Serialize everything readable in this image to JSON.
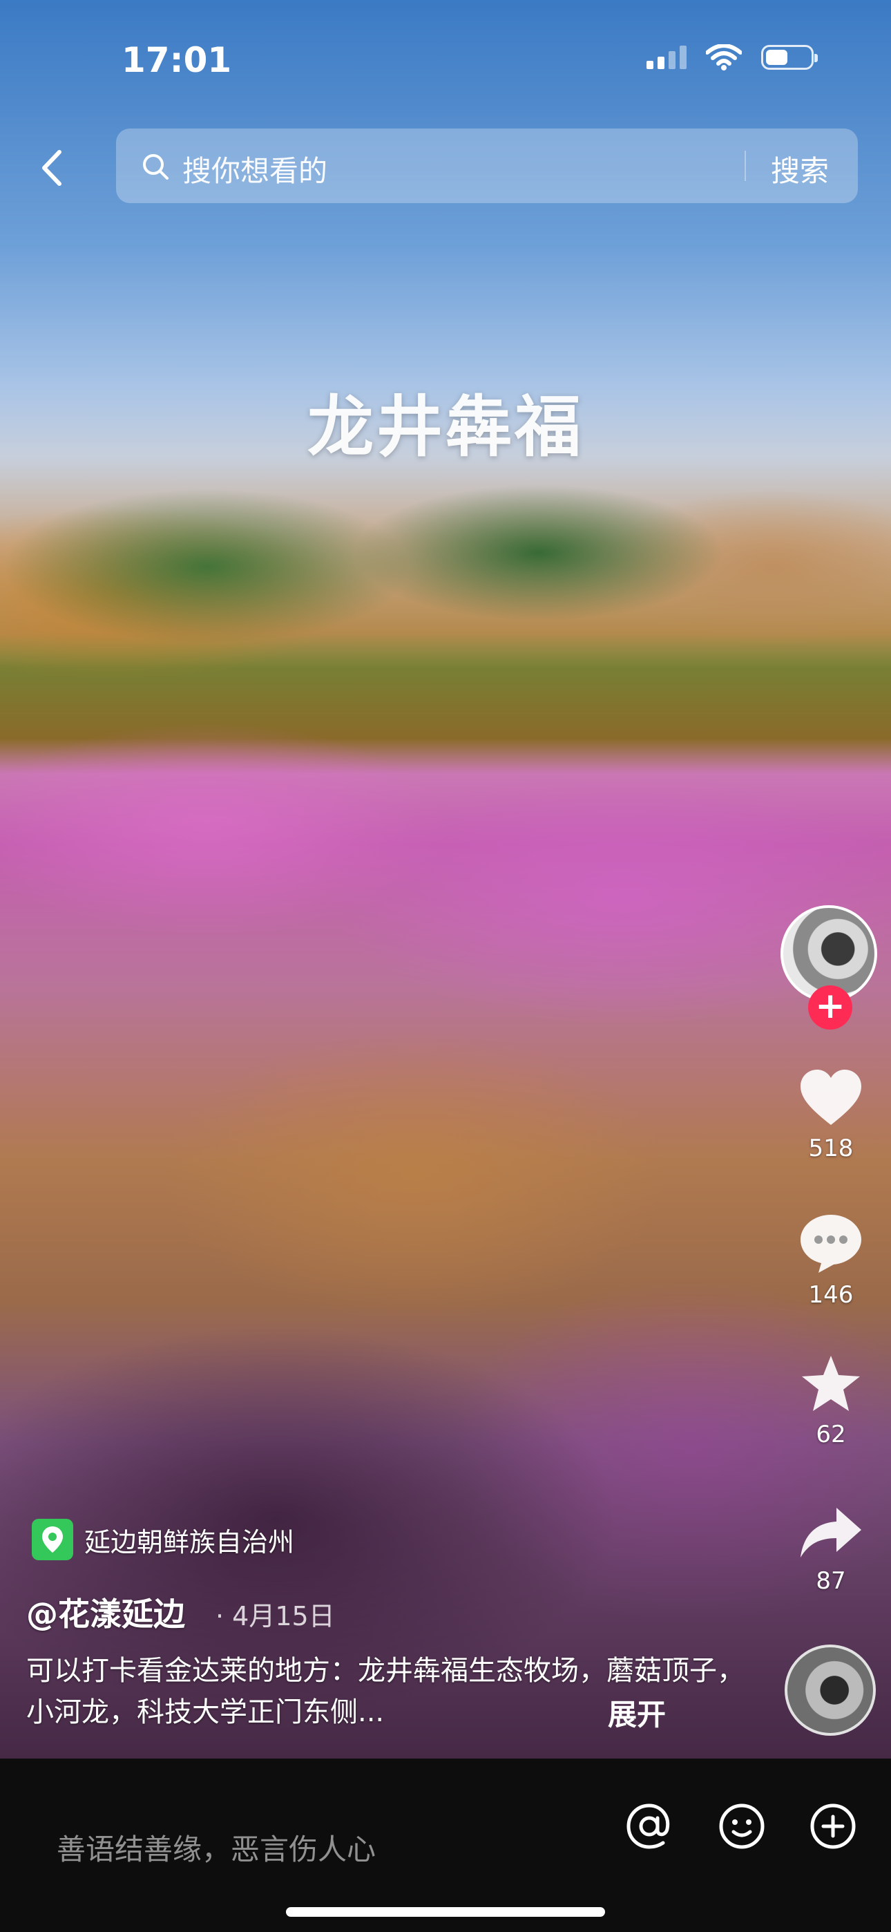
{
  "status_bar": {
    "time": "17:01",
    "battery_level": 0.5
  },
  "search": {
    "placeholder": "搜你想看的",
    "button_label": "搜索"
  },
  "video": {
    "overlay_title": "龙井犇福"
  },
  "actions": {
    "likes": "518",
    "comments": "146",
    "favorites": "62",
    "shares": "87"
  },
  "post": {
    "location": "延边朝鲜族自治州",
    "author": "@花漾延边",
    "date": "· 4月15日",
    "caption": "可以打卡看金达莱的地方：龙井犇福生态牧场，蘑菇顶子，小河龙，科技大学正门东侧...",
    "expand_label": "展开"
  },
  "comment_bar": {
    "placeholder": "善语结善缘，恶言伤人心"
  },
  "icons": [
    "back-icon",
    "search-icon",
    "heart-icon",
    "comment-icon",
    "star-icon",
    "share-icon",
    "at-icon",
    "emoji-icon",
    "plus-icon",
    "location-pin-icon"
  ]
}
